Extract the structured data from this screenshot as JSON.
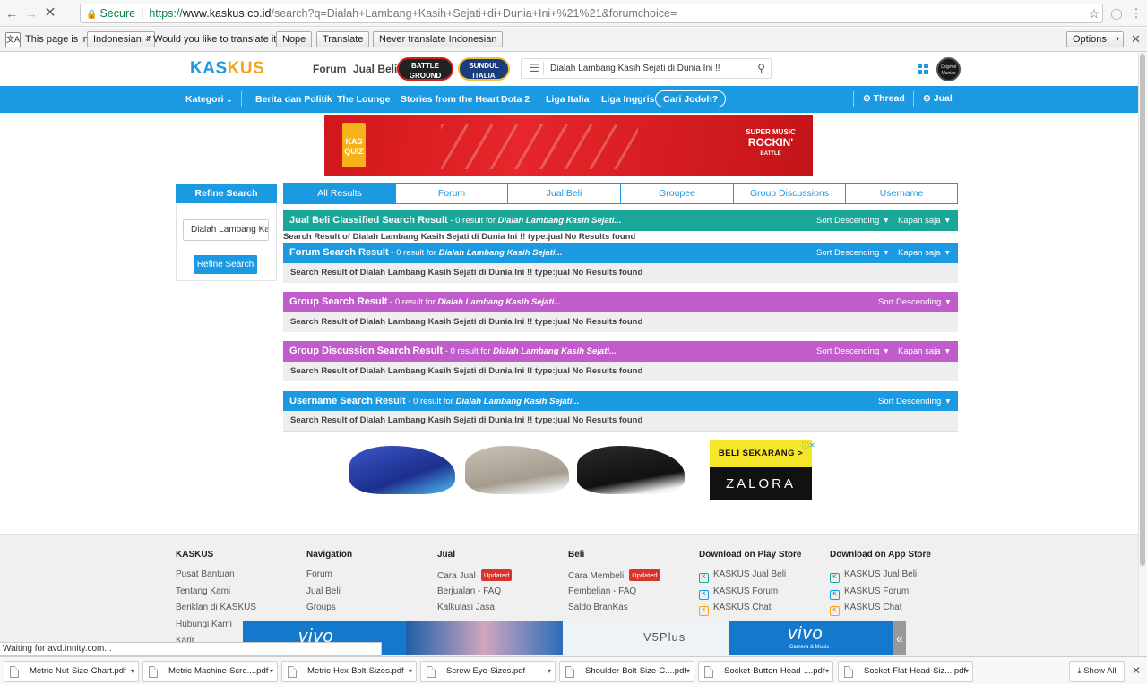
{
  "browser": {
    "secure_label": "Secure",
    "url_scheme": "https://",
    "url_domain": "www.kaskus.co.id",
    "url_path": "/search?q=Dialah+Lambang+Kasih+Sejati+di+Dunia+Ini+%21%21&forumchoice="
  },
  "translate_bar": {
    "prefix": "This page is in",
    "language": "Indonesian",
    "question": "Would you like to translate it?",
    "nope": "Nope",
    "translate": "Translate",
    "never": "Never translate Indonesian",
    "options": "Options"
  },
  "header": {
    "logo_part1": "KAS",
    "logo_part2": "KUS",
    "forum": "Forum",
    "jual_beli": "Jual Beli",
    "badge1": "BATTLE GROUND",
    "badge2": "SUNDUL ITALIA",
    "search_value": "Dialah Lambang Kasih Sejati di Dunia Ini !!",
    "profile_badge": "Original Maniac"
  },
  "nav": {
    "kategori": "Kategori",
    "items": [
      "Berita dan Politik",
      "The Lounge",
      "Stories from the Heart",
      "Dota 2",
      "Liga Italia",
      "Liga Inggris"
    ],
    "cari_jodoh": "Cari Jodoh?",
    "thread": "Thread",
    "jual": "Jual"
  },
  "banner": {
    "kas": "KAS",
    "quiz": "QUIZ",
    "sm1": "SUPER",
    "sm2": "MUSIC",
    "sm3": "ROCKIN'",
    "sm4": "BATTLE"
  },
  "sidebar": {
    "title": "Refine Search",
    "input_value": "Dialah Lambang Kasih Sejati di Dunia Ini !!",
    "button": "Refine Search"
  },
  "tabs": [
    "All Results",
    "Forum",
    "Jual Beli",
    "Groupee",
    "Group Discussions",
    "Username"
  ],
  "sections": [
    {
      "title": "Jual Beli Classified Search Result",
      "count": " - 0 result for ",
      "query": "Dialah Lambang Kasih Sejati...",
      "sort": "Sort Descending",
      "time": "Kapan saja",
      "color": "#1aa79a",
      "result": "Search Result of Dialah Lambang Kasih Sejati di Dunia Ini !! type:jual No Results found"
    },
    {
      "title": "Forum Search Result",
      "count": " - 0 result for ",
      "query": "Dialah Lambang Kasih Sejati...",
      "sort": "Sort Descending",
      "time": "Kapan saja",
      "color": "#1b9ae2",
      "result": "Search Result of Dialah Lambang Kasih Sejati di Dunia Ini !! type:jual No Results found"
    },
    {
      "title": "Group Search Result",
      "count": " - 0 result for ",
      "query": "Dialah Lambang Kasih Sejati...",
      "sort": "Sort Descending",
      "time": "",
      "color": "#c05dcb",
      "result": "Search Result of Dialah Lambang Kasih Sejati di Dunia Ini !! type:jual No Results found"
    },
    {
      "title": "Group Discussion Search Result",
      "count": " - 0 result for ",
      "query": "Dialah Lambang Kasih Sejati...",
      "sort": "Sort Descending",
      "time": "Kapan saja",
      "color": "#c05dcb",
      "result": "Search Result of Dialah Lambang Kasih Sejati di Dunia Ini !! type:jual No Results found"
    },
    {
      "title": "Username Search Result",
      "count": " - 0 result for ",
      "query": "Dialah Lambang Kasih Sejati...",
      "sort": "Sort Descending",
      "time": "",
      "color": "#1b9ae2",
      "result": "Search Result of Dialah Lambang Kasih Sejati di Dunia Ini !! type:jual No Results found"
    }
  ],
  "ad": {
    "cta": "BELI SEKARANG >",
    "brand": "ZALORA"
  },
  "footer": {
    "columns": [
      {
        "title": "KASKUS",
        "links": [
          "Pusat Bantuan",
          "Tentang Kami",
          "Beriklan di KASKUS",
          "Hubungi Kami",
          "Karir"
        ]
      },
      {
        "title": "Navigation",
        "links": [
          "Forum",
          "Jual Beli",
          "Groups"
        ]
      },
      {
        "title": "Jual",
        "links": [
          "Cara Jual",
          "Berjualan - FAQ",
          "Kalkulasi Jasa"
        ]
      },
      {
        "title": "Beli",
        "links": [
          "Cara Membeli",
          "Pembelian - FAQ",
          "Saldo BranKas"
        ]
      },
      {
        "title": "Download on Play Store",
        "links": [
          "KASKUS Jual Beli",
          "KASKUS Forum",
          "KASKUS Chat"
        ]
      },
      {
        "title": "Download on App Store",
        "links": [
          "KASKUS Jual Beli",
          "KASKUS Forum",
          "KASKUS Chat"
        ]
      }
    ],
    "updated": "Updated"
  },
  "vivo_ad": {
    "brand": "vivo",
    "model": "V5Plus",
    "tagline": "Camera & Music"
  },
  "status_text": "Waiting for avd.innity.com...",
  "downloads": [
    "Metric-Nut-Size-Chart.pdf",
    "Metric-Machine-Scre....pdf",
    "Metric-Hex-Bolt-Sizes.pdf",
    "Screw-Eye-Sizes.pdf",
    "Shoulder-Bolt-Size-C....pdf",
    "Socket-Button-Head-....pdf",
    "Socket-Flat-Head-Siz....pdf"
  ],
  "show_all": "Show All"
}
